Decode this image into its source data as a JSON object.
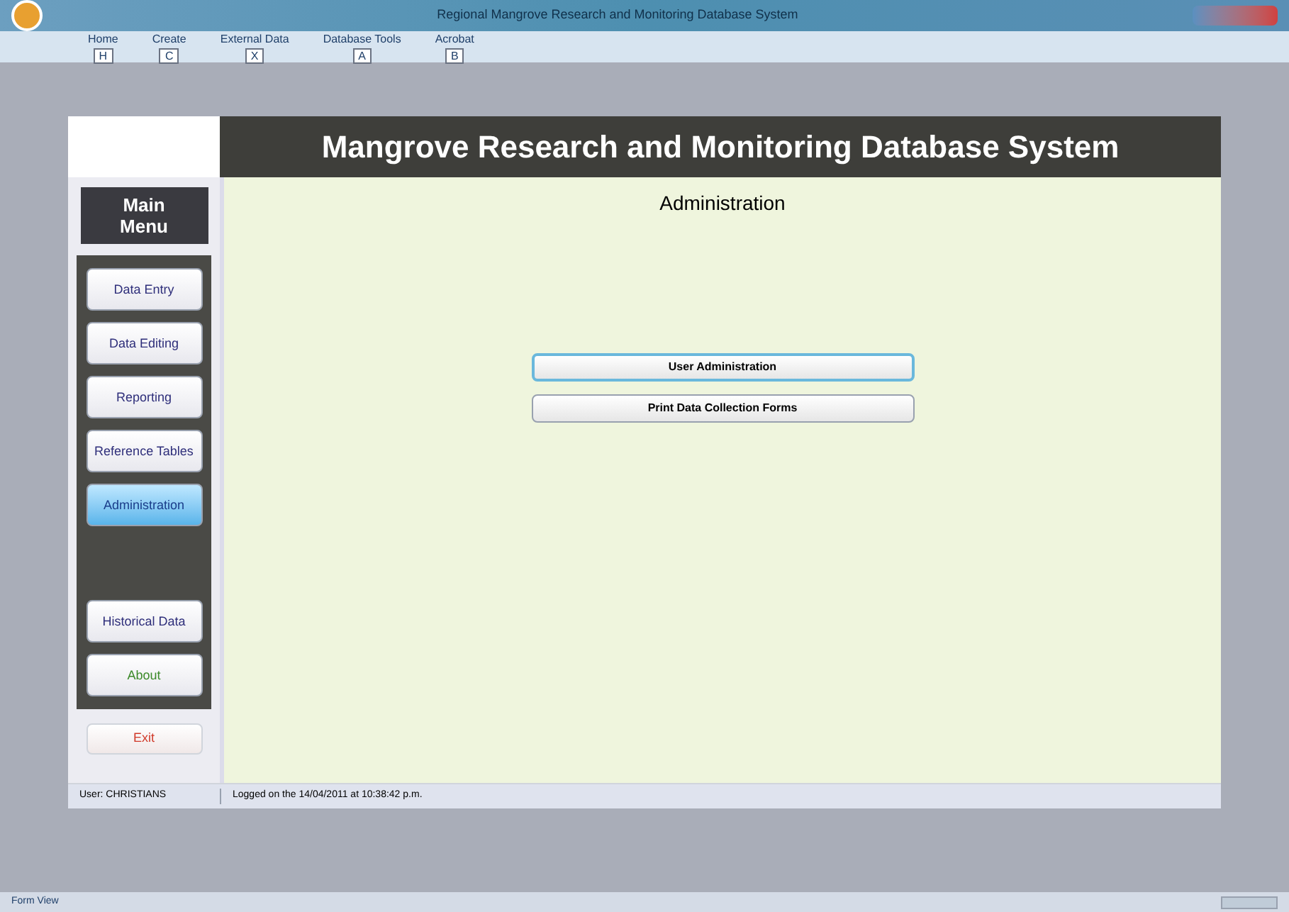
{
  "window": {
    "title": "Regional Mangrove Research and Monitoring Database System"
  },
  "ribbon_tabs": [
    {
      "label": "Home",
      "key": "H"
    },
    {
      "label": "Create",
      "key": "C"
    },
    {
      "label": "External Data",
      "key": "X"
    },
    {
      "label": "Database Tools",
      "key": "A"
    },
    {
      "label": "Acrobat",
      "key": "B"
    }
  ],
  "header": {
    "title": "Mangrove Research and Monitoring Database System"
  },
  "main_menu": {
    "title": "Main Menu",
    "items": [
      {
        "label": "Data Entry",
        "selected": false
      },
      {
        "label": "Data Editing",
        "selected": false
      },
      {
        "label": "Reporting",
        "selected": false
      },
      {
        "label": "Reference Tables",
        "selected": false
      },
      {
        "label": "Administration",
        "selected": true
      }
    ],
    "lower_items": [
      {
        "label": "Historical Data",
        "kind": "normal"
      },
      {
        "label": "About",
        "kind": "about"
      }
    ],
    "exit": "Exit"
  },
  "content": {
    "heading": "Administration",
    "buttons": [
      {
        "label": "User Administration",
        "focused": true
      },
      {
        "label": "Print Data Collection Forms",
        "focused": false
      }
    ]
  },
  "form_status": {
    "user": "User: CHRISTIANS",
    "login": "Logged on the 14/04/2011 at 10:38:42 p.m."
  },
  "status_bar": {
    "text": "Form View"
  }
}
